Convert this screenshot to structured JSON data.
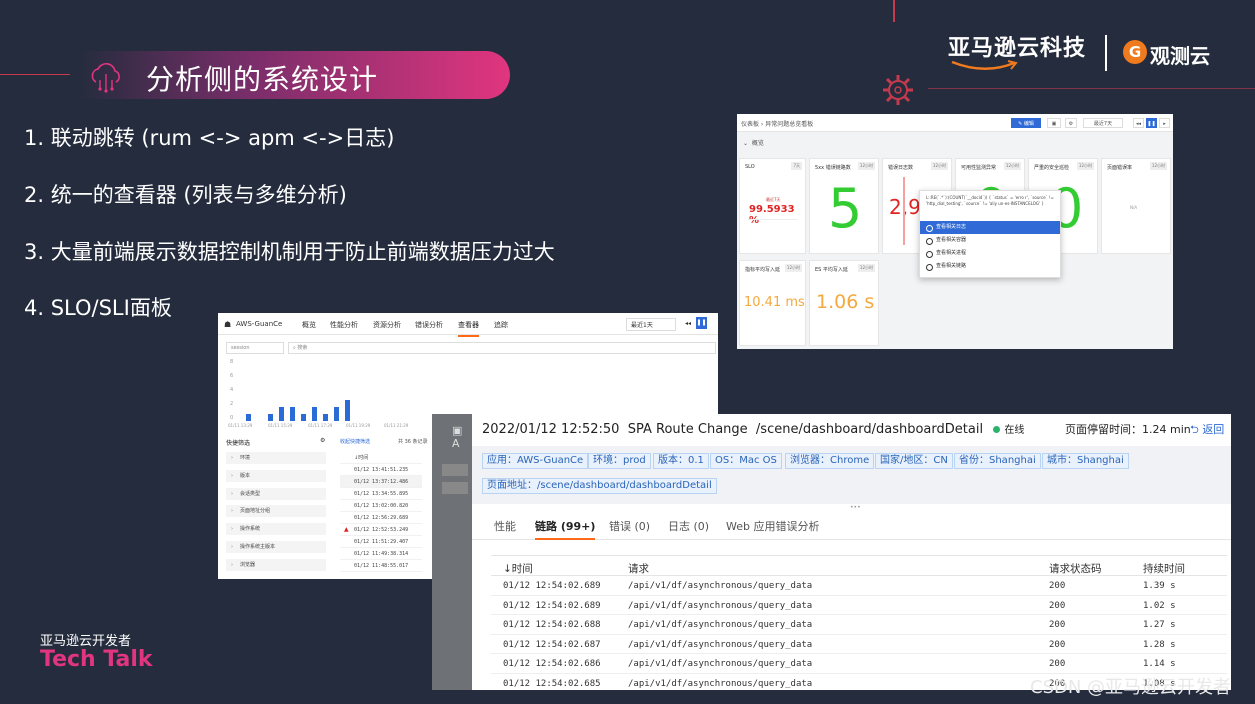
{
  "slide": {
    "title": "分析侧的系统设计",
    "brand_name": "亚马逊云科技",
    "partner_logo_glyph": "G",
    "partner_name": "观测云",
    "bullets": [
      "1.  联动跳转 (rum <-> apm <->日志)",
      "2.  统一的查看器 (列表与多维分析)",
      "3.  大量前端展示数据控制机制用于防止前端数据压力过大",
      "4.  SLO/SLI面板"
    ],
    "footer_small": "亚马逊云开发者",
    "footer_big": "Tech Talk",
    "watermark": "CSDN @亚马逊云开发者",
    "accent_color": "#e1357f",
    "brand_color": "#f07a1e"
  },
  "dashboard": {
    "breadcrumb": "仪表板 › 异常问题总览看板",
    "edit_label": "编辑",
    "time_label": "最近7天",
    "section": "概览",
    "cards": [
      {
        "title": "SLO",
        "tag": "7天",
        "value": "99.5933 %",
        "sub": "最近7天"
      },
      {
        "title": "5xx 错误链路数",
        "tag": "12小时",
        "value": "5"
      },
      {
        "title": "错误日志数",
        "tag": "12小时",
        "value": "2,9"
      },
      {
        "title": "可用性监测异常",
        "tag": "12小时",
        "value": "0"
      },
      {
        "title": "严重的安全巡检",
        "tag": "12小时",
        "value": "0"
      },
      {
        "title": "页面错误率",
        "tag": "12小时",
        "value": "N/A"
      },
      {
        "title": "指标平均写入延",
        "tag": "12小时",
        "value": "10.41 ms"
      },
      {
        "title": "ES 平均写入延",
        "tag": "12小时",
        "value": "1.06 s"
      }
    ],
    "query_text": "L::RE(`.*`):(COUNT(`__docid`)) { `status` = 'erro r', `source` != 'http_dial_testing', `source` != 'aliy un-es-INSTANCELOG' }",
    "menu_items": [
      "查看相关日志",
      "查看相关容器",
      "查看相关进程",
      "查看相关链路"
    ]
  },
  "explorer": {
    "app_name": "AWS-GuanCe",
    "nav_items": [
      "概览",
      "性能分析",
      "资源分析",
      "错误分析",
      "查看器",
      "追踪"
    ],
    "time_range": "最近1天",
    "source_select": "session",
    "search_placeholder": "搜索",
    "y_ticks": [
      "8",
      "6",
      "4",
      "2",
      "0"
    ],
    "x_ticks": [
      "01/11 13:29",
      "01/11 15:29",
      "01/11 17:29",
      "01/11 19:29",
      "01/11 21:29"
    ],
    "chart_data": {
      "type": "bar",
      "values": [
        1,
        0,
        1,
        2,
        2,
        1,
        2,
        1,
        2,
        3
      ],
      "ylim": [
        0,
        8
      ]
    },
    "filter_title": "快捷筛选",
    "collapse_label": "收起快捷筛选",
    "count_label": "共 36 条记录",
    "filters": [
      "环境",
      "版本",
      "会话类型",
      "页面地址分组",
      "操作系统",
      "操作系统主版本",
      "浏览器"
    ],
    "time_header": "↓时间",
    "times": [
      "01/12 13:41:51.235",
      "01/12 13:37:12.486",
      "01/12 13:34:55.895",
      "01/12 13:02:00.820",
      "01/12 12:56:29.689",
      "01/12 12:52:53.249",
      "01/12 11:51:29.407",
      "01/12 11:49:38.314",
      "01/12 11:48:55.017"
    ]
  },
  "detail": {
    "timestamp": "2022/01/12 12:52:50",
    "event": "SPA Route Change",
    "path": "/scene/dashboard/dashboardDetail",
    "status": "在线",
    "stay_label": "页面停留时间：1.24 min",
    "back_label": "返回",
    "tags": [
      "应用：AWS-GuanCe",
      "环境：prod",
      "版本：0.1",
      "OS：Mac OS",
      "浏览器：Chrome",
      "国家/地区：CN",
      "省份：Shanghai",
      "城市：Shanghai",
      "页面地址：/scene/dashboard/dashboardDetail"
    ],
    "tabs": [
      "性能",
      "链路 (99+)",
      "错误 (0)",
      "日志 (0)",
      "Web 应用错误分析"
    ],
    "columns": [
      "↓时间",
      "请求",
      "请求状态码",
      "持续时间"
    ],
    "rows": [
      [
        "01/12 12:54:02.689",
        "/api/v1/df/asynchronous/query_data",
        "200",
        "1.39 s"
      ],
      [
        "01/12 12:54:02.689",
        "/api/v1/df/asynchronous/query_data",
        "200",
        "1.02 s"
      ],
      [
        "01/12 12:54:02.688",
        "/api/v1/df/asynchronous/query_data",
        "200",
        "1.27 s"
      ],
      [
        "01/12 12:54:02.687",
        "/api/v1/df/asynchronous/query_data",
        "200",
        "1.28 s"
      ],
      [
        "01/12 12:54:02.686",
        "/api/v1/df/asynchronous/query_data",
        "200",
        "1.14 s"
      ],
      [
        "01/12 12:54:02.685",
        "/api/v1/df/asynchronous/query_data",
        "200",
        "1.08 s"
      ]
    ]
  }
}
